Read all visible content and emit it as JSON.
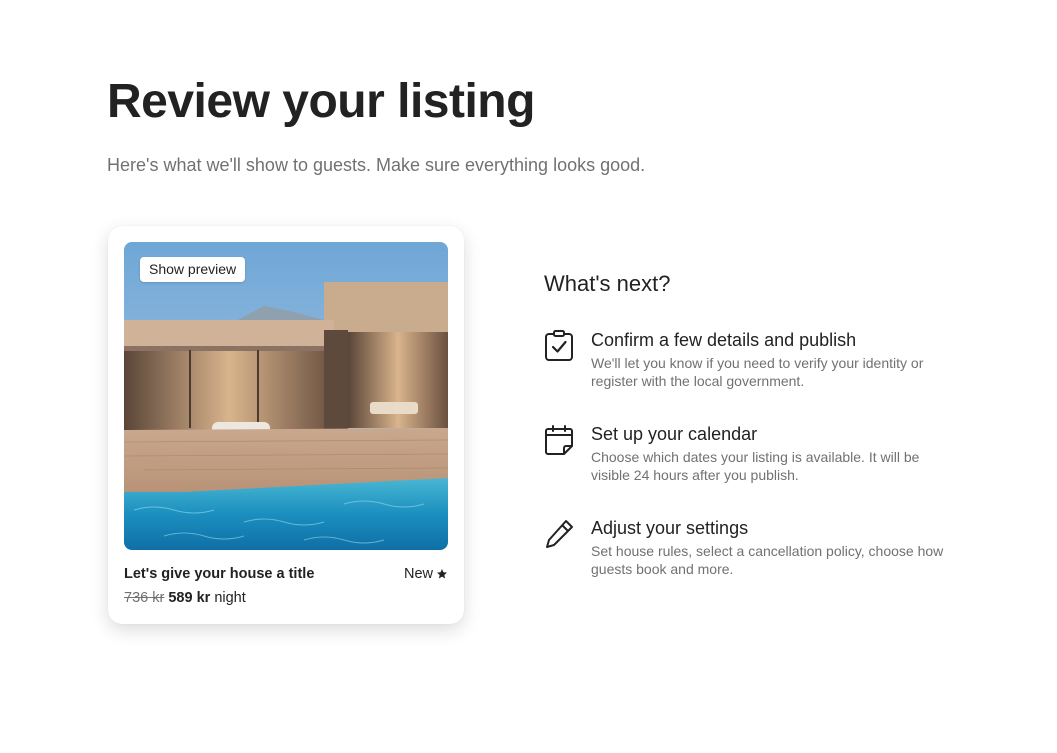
{
  "header": {
    "title": "Review your listing",
    "subtitle": "Here's what we'll show to guests. Make sure everything looks good."
  },
  "listing_card": {
    "preview_button": "Show preview",
    "title": "Let's give your house a title",
    "rating_label": "New",
    "rating_icon": "star-icon",
    "old_price": "736 kr",
    "new_price": "589 kr",
    "price_unit": "night"
  },
  "whats_next": {
    "title": "What's next?",
    "steps": [
      {
        "icon": "clipboard-check-icon",
        "title": "Confirm a few details and publish",
        "description": "We'll let you know if you need to verify your identity or register with the local government."
      },
      {
        "icon": "calendar-icon",
        "title": "Set up your calendar",
        "description": "Choose which dates your listing is available. It will be visible 24 hours after you publish."
      },
      {
        "icon": "pencil-icon",
        "title": "Adjust your settings",
        "description": "Set house rules, select a cancellation policy, choose how guests book and more."
      }
    ]
  },
  "colors": {
    "text_primary": "#222222",
    "text_secondary": "#717171",
    "background": "#ffffff"
  }
}
